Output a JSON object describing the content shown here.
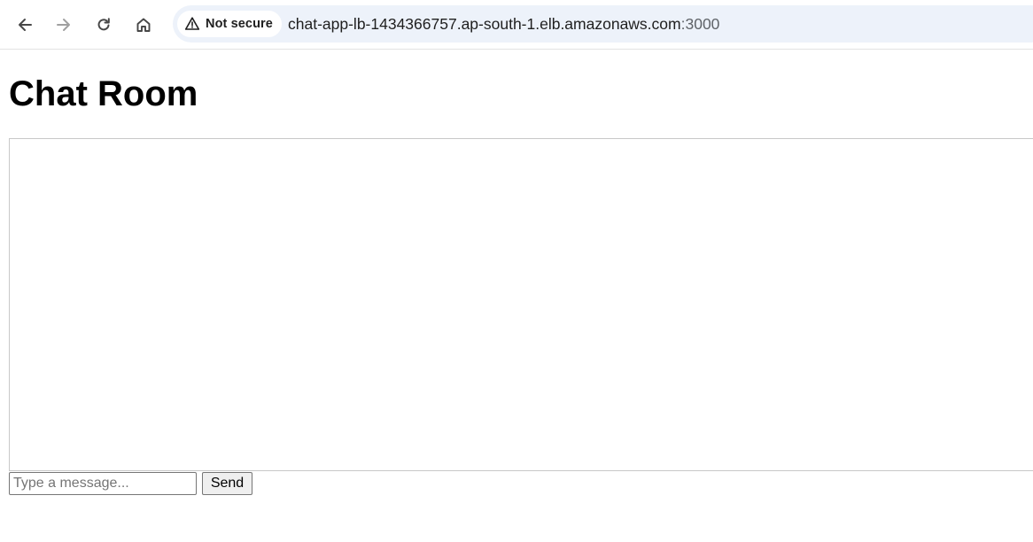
{
  "browser": {
    "back_icon": "arrow-left-icon",
    "forward_icon": "arrow-right-icon",
    "reload_icon": "reload-icon",
    "home_icon": "home-icon",
    "security_label": "Not secure",
    "security_icon": "warning-triangle-icon",
    "url_host": "chat-app-lb-1434366757.ap-south-1.elb.amazonaws.com",
    "url_port": ":3000"
  },
  "page": {
    "title": "Chat Room",
    "message_placeholder": "Type a message...",
    "message_value": "",
    "send_label": "Send"
  },
  "colors": {
    "omnibox_bg": "#edf2fa",
    "icon_color": "#474747",
    "forward_disabled": "#a0a0a0"
  }
}
